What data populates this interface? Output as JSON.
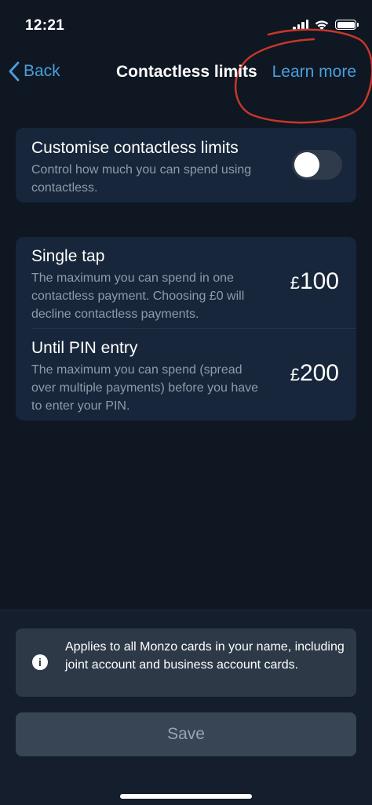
{
  "status_bar": {
    "time": "12:21"
  },
  "nav": {
    "back_label": "Back",
    "title": "Contactless limits",
    "learn_more_label": "Learn more"
  },
  "customise": {
    "title": "Customise contactless limits",
    "description": "Control how much you can spend using contactless.",
    "toggle_on": false
  },
  "limits": [
    {
      "title": "Single tap",
      "description": "The maximum you can spend in one contactless payment. Choosing £0 will decline contactless payments.",
      "currency": "£",
      "amount": "100"
    },
    {
      "title": "Until PIN entry",
      "description": "The maximum you can spend (spread over multiple payments) before you have to enter your PIN.",
      "currency": "£",
      "amount": "200"
    }
  ],
  "footer": {
    "info_text": "Applies to all Monzo cards in your name, including joint account and business account cards.",
    "save_label": "Save"
  },
  "icons": [
    "chevron-left-icon",
    "info-icon",
    "wifi-icon",
    "signal-icon",
    "battery-icon"
  ],
  "colors": {
    "accent": "#4b9edc",
    "background": "#0f1723",
    "card": "#17263a",
    "annotation": "#c8362b"
  }
}
